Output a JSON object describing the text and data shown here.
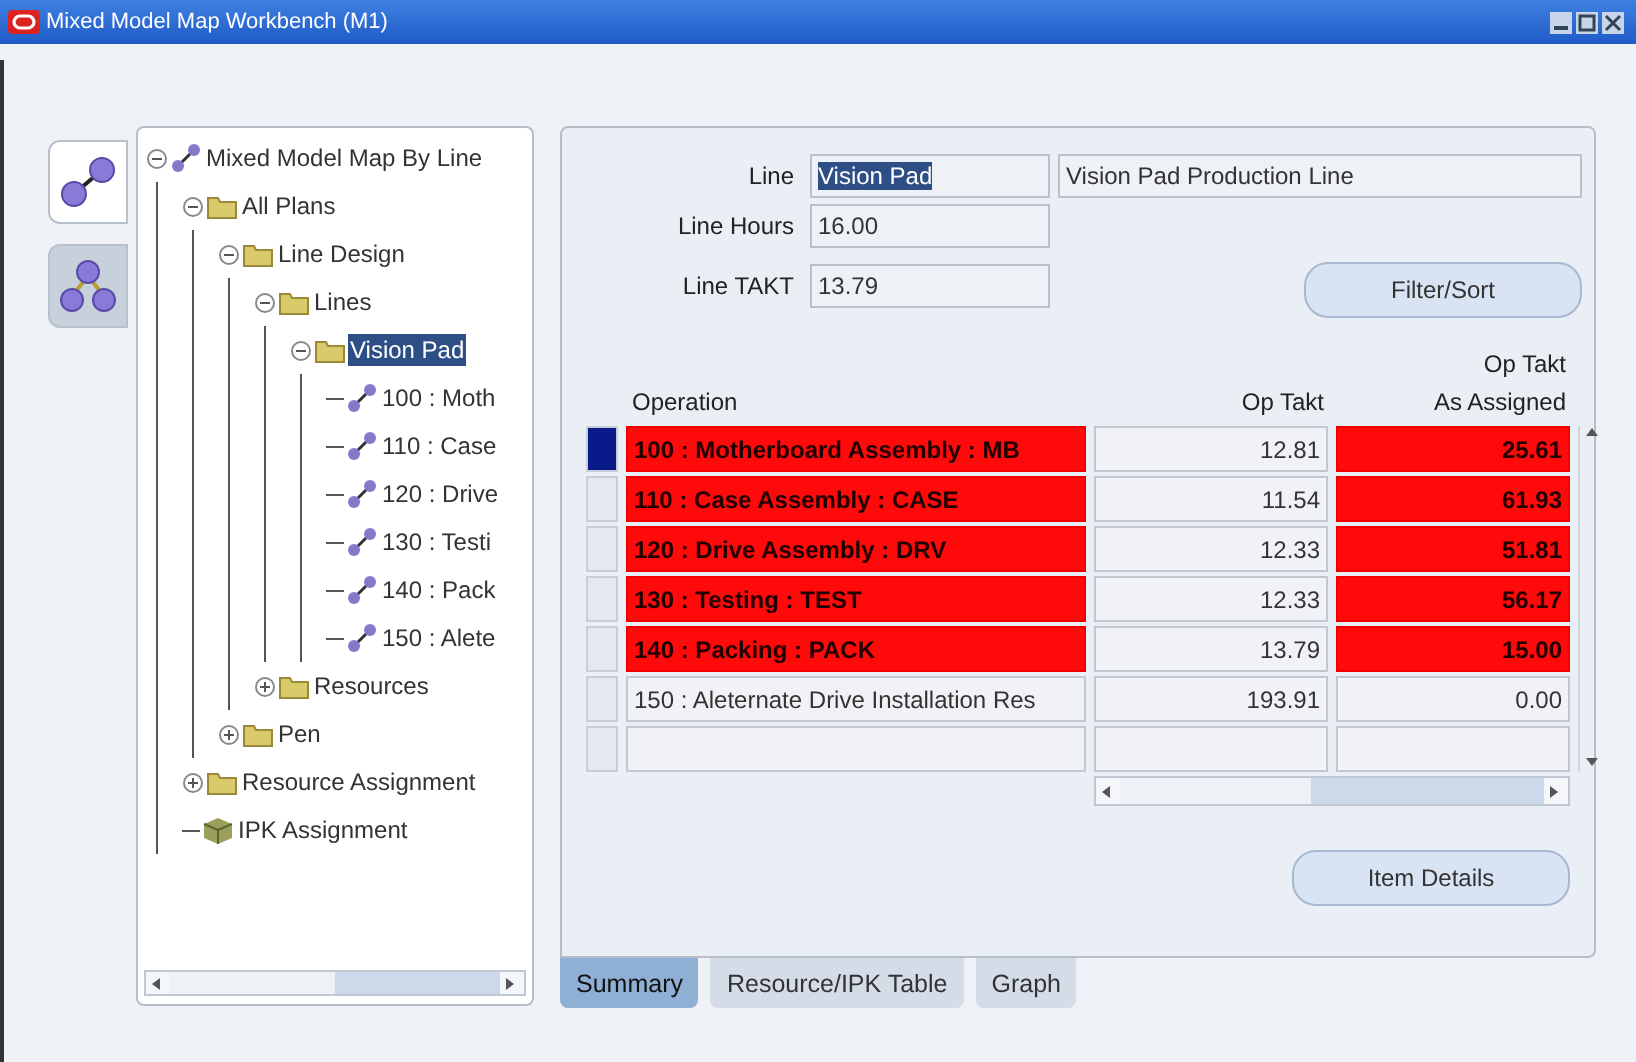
{
  "window": {
    "title": "Mixed Model Map Workbench (M1)"
  },
  "side_tabs": [
    {
      "kind": "map",
      "selected": true
    },
    {
      "kind": "network",
      "selected": false
    }
  ],
  "tree": {
    "items": [
      {
        "label": "Mixed Model Map By Line",
        "kind": "model",
        "expanded": true,
        "selected": false,
        "children": [
          {
            "label": "All Plans",
            "kind": "folder",
            "expanded": true,
            "selected": false,
            "children": [
              {
                "label": "Line Design",
                "kind": "folder",
                "expanded": true,
                "selected": false,
                "children": [
                  {
                    "label": "Lines",
                    "kind": "folder",
                    "expanded": true,
                    "selected": false,
                    "children": [
                      {
                        "label": "Vision Pad",
                        "kind": "folder",
                        "expanded": true,
                        "selected": true,
                        "children": [
                          {
                            "label": "100 : Moth",
                            "kind": "operation",
                            "selected": false
                          },
                          {
                            "label": "110 : Case",
                            "kind": "operation",
                            "selected": false
                          },
                          {
                            "label": "120 : Drive",
                            "kind": "operation",
                            "selected": false
                          },
                          {
                            "label": "130 : Testi",
                            "kind": "operation",
                            "selected": false
                          },
                          {
                            "label": "140 : Pack",
                            "kind": "operation",
                            "selected": false
                          },
                          {
                            "label": "150 : Alete",
                            "kind": "operation",
                            "selected": false
                          }
                        ]
                      }
                    ]
                  },
                  {
                    "label": "Resources",
                    "kind": "folder",
                    "expanded": false,
                    "selected": false
                  }
                ]
              },
              {
                "label": "Pen",
                "kind": "folder",
                "expanded": false,
                "selected": false
              }
            ]
          },
          {
            "label": "Resource Assignment",
            "kind": "folder",
            "expanded": false,
            "selected": false
          },
          {
            "label": "IPK Assignment",
            "kind": "cube",
            "selected": false
          }
        ]
      }
    ]
  },
  "form": {
    "line_label": "Line",
    "line_value": "Vision Pad",
    "line_description": "Vision Pad Production Line",
    "hours_label": "Line Hours",
    "hours_value": "16.00",
    "takt_label": "Line TAKT",
    "takt_value": "13.79",
    "filter_button": "Filter/Sort"
  },
  "table": {
    "columns": [
      "Operation",
      "Op Takt",
      "Op Takt\nAs Assigned"
    ],
    "rows": [
      {
        "operation": "100 : Motherboard Assembly : MB",
        "op_takt": "12.81",
        "assigned": "25.61",
        "over": true,
        "selected": true
      },
      {
        "operation": "110 : Case Assembly : CASE",
        "op_takt": "11.54",
        "assigned": "61.93",
        "over": true,
        "selected": false
      },
      {
        "operation": "120 : Drive Assembly : DRV",
        "op_takt": "12.33",
        "assigned": "51.81",
        "over": true,
        "selected": false
      },
      {
        "operation": "130 : Testing : TEST",
        "op_takt": "12.33",
        "assigned": "56.17",
        "over": true,
        "selected": false
      },
      {
        "operation": "140 : Packing : PACK",
        "op_takt": "13.79",
        "assigned": "15.00",
        "over": true,
        "selected": false
      },
      {
        "operation": "150 : Aleternate Drive Installation Res",
        "op_takt": "193.91",
        "assigned": "0.00",
        "over": false,
        "selected": false
      }
    ]
  },
  "item_details_button": "Item Details",
  "tabs": [
    {
      "label": "Summary",
      "selected": true
    },
    {
      "label": "Resource/IPK Table",
      "selected": false
    },
    {
      "label": "Graph",
      "selected": false
    }
  ]
}
